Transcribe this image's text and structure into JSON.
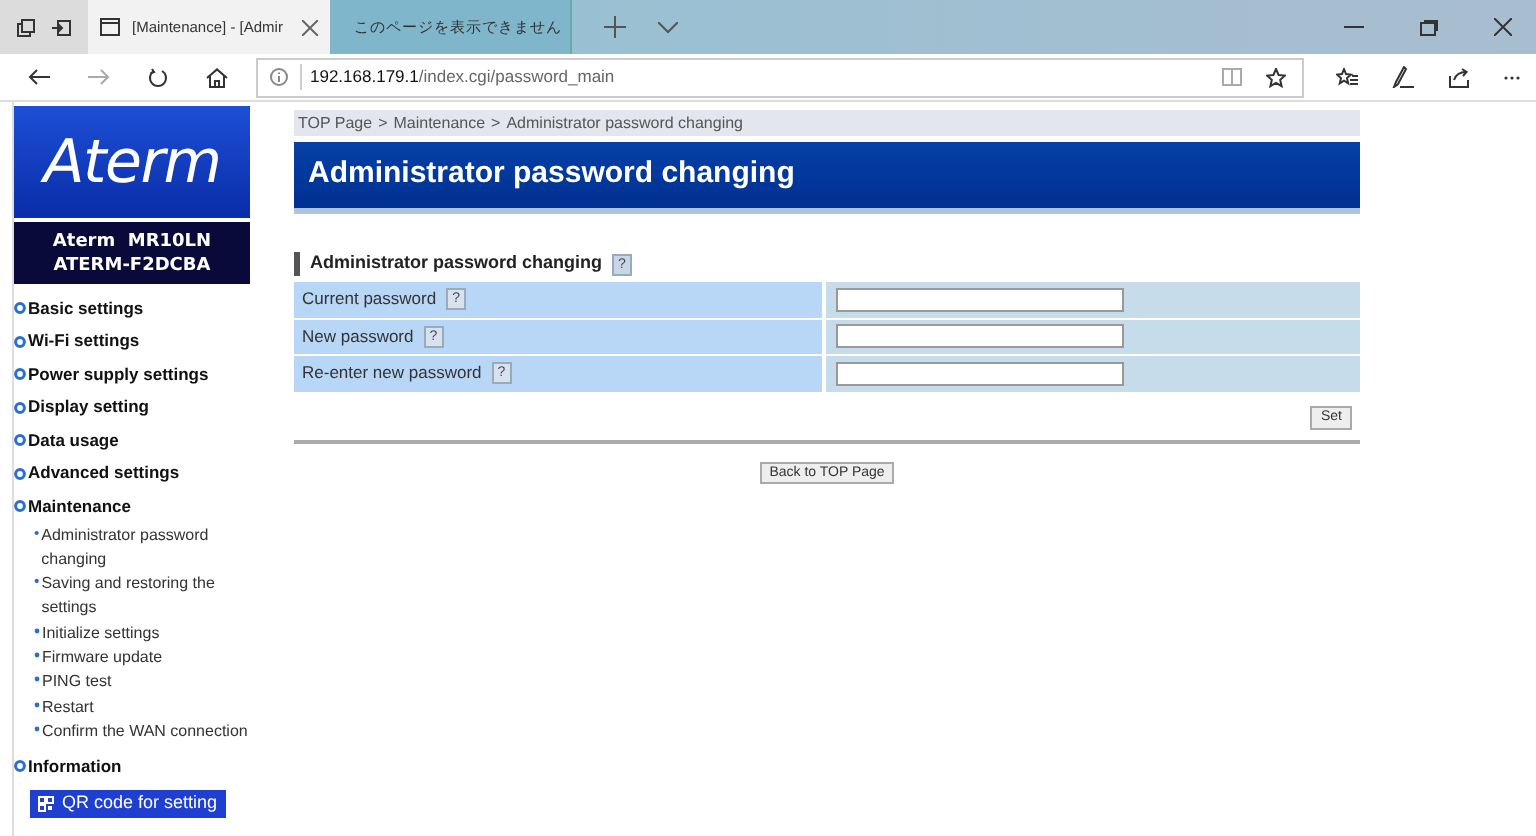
{
  "browser": {
    "tabs": [
      {
        "label": "[Maintenance] - [Admir",
        "selected": true
      },
      {
        "label": "このページを表示できません",
        "selected": false
      }
    ],
    "url": {
      "host": "192.168.179.1",
      "path": "/index.cgi/password_main"
    }
  },
  "sidebar": {
    "logo": "Aterm",
    "device": [
      "Aterm  MR10LN",
      "ATERM-F2DCBA"
    ],
    "menu": [
      {
        "label": "Basic settings"
      },
      {
        "label": "Wi-Fi settings"
      },
      {
        "label": "Power supply settings"
      },
      {
        "label": "Display setting"
      },
      {
        "label": "Data usage"
      },
      {
        "label": "Advanced settings"
      },
      {
        "label": "Maintenance",
        "children": [
          {
            "label": "Administrator password changing"
          },
          {
            "label": "Saving and restoring the settings"
          },
          {
            "label": "Initialize settings"
          },
          {
            "label": "Firmware update"
          },
          {
            "label": "PING test"
          },
          {
            "label": "Restart"
          },
          {
            "label": "Confirm the WAN connection"
          }
        ]
      },
      {
        "label": "Information"
      }
    ],
    "qr_button": "QR code for setting"
  },
  "breadcrumb": {
    "items": [
      "TOP Page",
      "Maintenance",
      "Administrator password changing"
    ],
    "separator": ">"
  },
  "page_title": "Administrator password changing",
  "section": {
    "title": "Administrator password changing",
    "help": "?"
  },
  "fields": [
    {
      "label": "Current password",
      "help": "?"
    },
    {
      "label": "New password",
      "help": "?"
    },
    {
      "label": "Re-enter new password",
      "help": "?"
    }
  ],
  "set_button": "Set",
  "back_button": "Back to TOP Page"
}
